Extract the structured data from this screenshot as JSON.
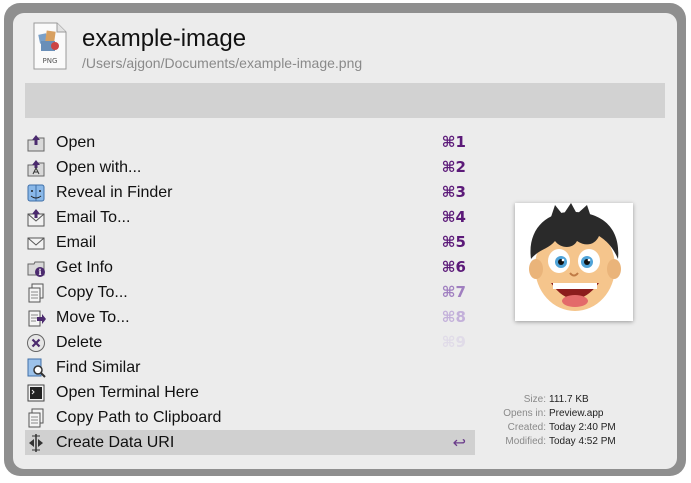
{
  "file": {
    "name": "example-image",
    "path": "/Users/ajgon/Documents/example-image.png",
    "type_badge": "PNG"
  },
  "search": {
    "value": "",
    "placeholder": ""
  },
  "actions": [
    {
      "label": "Open",
      "shortcut": "⌘1",
      "icon": "open-icon"
    },
    {
      "label": "Open with...",
      "shortcut": "⌘2",
      "icon": "open-with-icon"
    },
    {
      "label": "Reveal in Finder",
      "shortcut": "⌘3",
      "icon": "finder-icon"
    },
    {
      "label": "Email To...",
      "shortcut": "⌘4",
      "icon": "email-to-icon"
    },
    {
      "label": "Email",
      "shortcut": "⌘5",
      "icon": "email-icon"
    },
    {
      "label": "Get Info",
      "shortcut": "⌘6",
      "icon": "info-icon"
    },
    {
      "label": "Copy To...",
      "shortcut": "⌘7",
      "icon": "copy-icon"
    },
    {
      "label": "Move To...",
      "shortcut": "⌘8",
      "icon": "move-icon"
    },
    {
      "label": "Delete",
      "shortcut": "⌘9",
      "icon": "delete-icon"
    },
    {
      "label": "Find Similar",
      "shortcut": "",
      "icon": "find-similar-icon"
    },
    {
      "label": "Open Terminal Here",
      "shortcut": "",
      "icon": "terminal-icon"
    },
    {
      "label": "Copy Path to Clipboard",
      "shortcut": "",
      "icon": "clipboard-icon"
    },
    {
      "label": "Create Data URI",
      "shortcut": "↩",
      "icon": "data-uri-icon",
      "selected": true
    }
  ],
  "meta": {
    "size_label": "Size:",
    "size_value": "111.7 KB",
    "opens_in_label": "Opens in:",
    "opens_in_value": "Preview.app",
    "created_label": "Created:",
    "created_value": "Today 2:40 PM",
    "modified_label": "Modified:",
    "modified_value": "Today 4:52 PM"
  },
  "colors": {
    "shortcut": "#5c1a79",
    "selected_row": "#d0d0d0",
    "search_bar": "#d2d2d2",
    "frame": "#8f8f8f"
  }
}
